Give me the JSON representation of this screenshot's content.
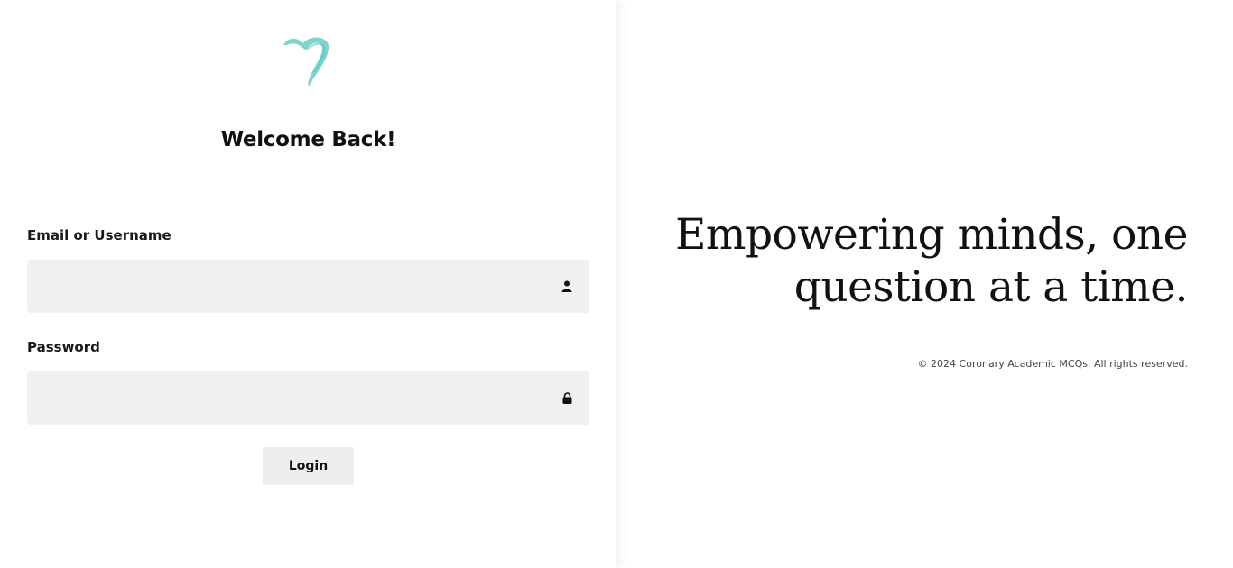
{
  "login_panel": {
    "heading": "Welcome Back!",
    "email_field": {
      "label": "Email or Username",
      "value": "",
      "icon": "user-icon"
    },
    "password_field": {
      "label": "Password",
      "value": "",
      "icon": "lock-icon"
    },
    "login_button": "Login"
  },
  "brand": {
    "logo_icon": "heart-swoosh-logo",
    "accent_color": "#7fd3cf"
  },
  "hero": {
    "tagline": "Empowering minds, one question at a time.",
    "copyright": "© 2024 Coronary Academic MCQs. All rights reserved."
  }
}
